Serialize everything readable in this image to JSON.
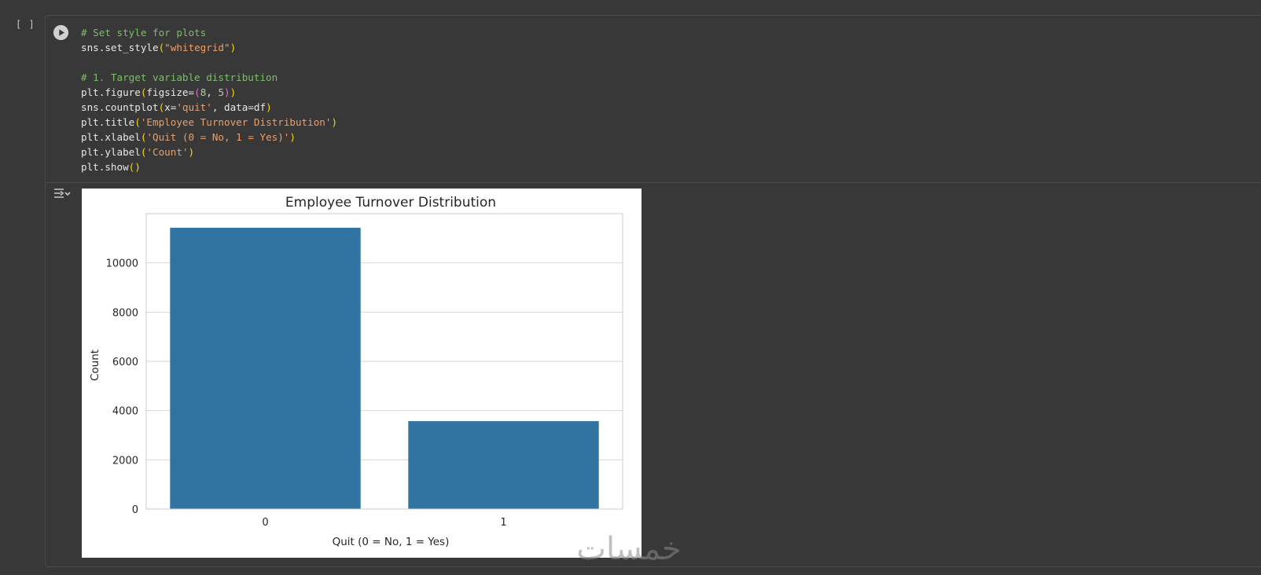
{
  "cell": {
    "execution_count": "[ ]",
    "code_lines": [
      [
        {
          "t": "# Set style for plots",
          "c": "c-comment"
        }
      ],
      [
        {
          "t": "sns.set_style"
        },
        {
          "t": "(",
          "c": "c-paren"
        },
        {
          "t": "\"whitegrid\"",
          "c": "c-str"
        },
        {
          "t": ")",
          "c": "c-paren"
        }
      ],
      [
        {
          "t": ""
        }
      ],
      [
        {
          "t": "# 1. Target variable distribution",
          "c": "c-comment"
        }
      ],
      [
        {
          "t": "plt.figure"
        },
        {
          "t": "(",
          "c": "c-paren"
        },
        {
          "t": "figsize="
        },
        {
          "t": "(",
          "c": "c-paren2"
        },
        {
          "t": "8",
          "c": "c-num"
        },
        {
          "t": ", "
        },
        {
          "t": "5",
          "c": "c-num"
        },
        {
          "t": ")",
          "c": "c-paren2"
        },
        {
          "t": ")",
          "c": "c-paren"
        }
      ],
      [
        {
          "t": "sns.countplot"
        },
        {
          "t": "(",
          "c": "c-paren"
        },
        {
          "t": "x="
        },
        {
          "t": "'quit'",
          "c": "c-str"
        },
        {
          "t": ", data=df"
        },
        {
          "t": ")",
          "c": "c-paren"
        }
      ],
      [
        {
          "t": "plt.title"
        },
        {
          "t": "(",
          "c": "c-paren"
        },
        {
          "t": "'Employee Turnover Distribution'",
          "c": "c-str"
        },
        {
          "t": ")",
          "c": "c-paren"
        }
      ],
      [
        {
          "t": "plt.xlabel"
        },
        {
          "t": "(",
          "c": "c-paren"
        },
        {
          "t": "'Quit (0 = No, 1 = Yes)'",
          "c": "c-str"
        },
        {
          "t": ")",
          "c": "c-paren"
        }
      ],
      [
        {
          "t": "plt.ylabel"
        },
        {
          "t": "(",
          "c": "c-paren"
        },
        {
          "t": "'Count'",
          "c": "c-str"
        },
        {
          "t": ")",
          "c": "c-paren"
        }
      ],
      [
        {
          "t": "plt.show"
        },
        {
          "t": "()",
          "c": "c-paren"
        }
      ]
    ]
  },
  "icons": {
    "run": "play-circle-icon",
    "output": "output-toggle-icon"
  },
  "watermark": {
    "text": "خمسات"
  },
  "chart_data": {
    "type": "bar",
    "title": "Employee Turnover Distribution",
    "xlabel": "Quit (0 = No, 1 = Yes)",
    "ylabel": "Count",
    "categories": [
      "0",
      "1"
    ],
    "values": [
      11428,
      3571
    ],
    "ylim": [
      0,
      12000
    ],
    "yticks": [
      0,
      2000,
      4000,
      6000,
      8000,
      10000
    ],
    "grid": true,
    "bar_color": "#3274a1"
  }
}
